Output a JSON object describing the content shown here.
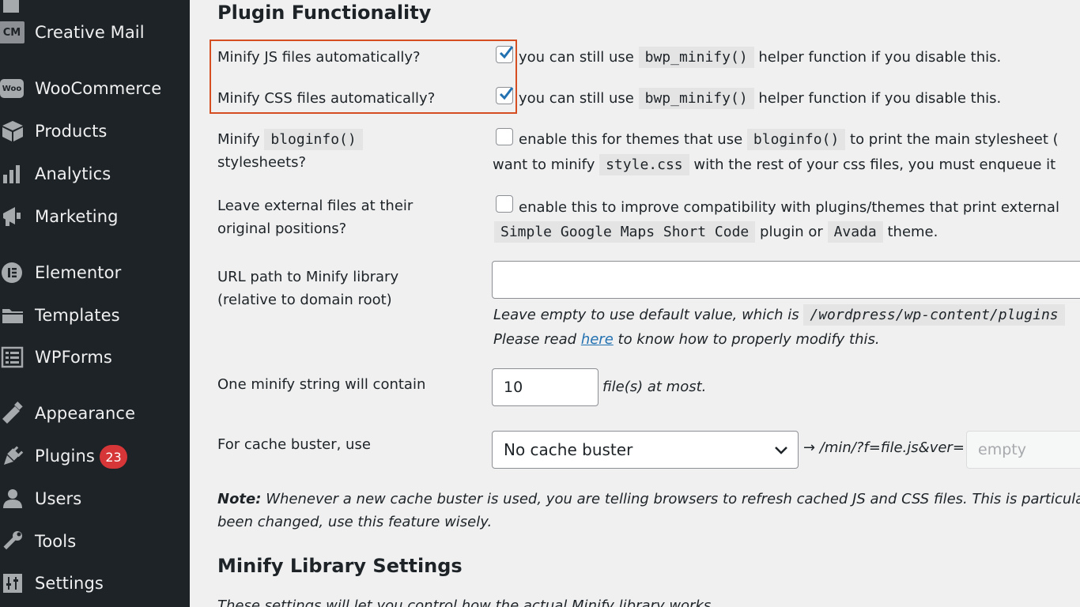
{
  "sidebar": {
    "items": [
      {
        "label": "Creative Mail",
        "icon": "creative-mail-icon",
        "icon_text": "CM"
      },
      {
        "label": "WooCommerce",
        "icon": "woocommerce-icon",
        "icon_text": "Woo"
      },
      {
        "label": "Products",
        "icon": "products-icon"
      },
      {
        "label": "Analytics",
        "icon": "analytics-icon"
      },
      {
        "label": "Marketing",
        "icon": "marketing-icon"
      },
      {
        "label": "Elementor",
        "icon": "elementor-icon"
      },
      {
        "label": "Templates",
        "icon": "templates-icon"
      },
      {
        "label": "WPForms",
        "icon": "wpforms-icon"
      },
      {
        "label": "Appearance",
        "icon": "appearance-icon"
      },
      {
        "label": "Plugins",
        "icon": "plugins-icon",
        "badge": "23"
      },
      {
        "label": "Users",
        "icon": "users-icon"
      },
      {
        "label": "Tools",
        "icon": "tools-icon"
      },
      {
        "label": "Settings",
        "icon": "settings-icon"
      }
    ]
  },
  "main": {
    "section_title": "Plugin Functionality",
    "js_row": {
      "label": "Minify JS files automatically?",
      "checked": true,
      "desc_pre": "you can still use",
      "code": "bwp_minify()",
      "desc_post": "helper function if you disable this."
    },
    "css_row": {
      "label": "Minify CSS files automatically?",
      "checked": true,
      "desc_pre": "you can still use",
      "code": "bwp_minify()",
      "desc_post": "helper function if you disable this."
    },
    "bloginfo_row": {
      "label_pre": "Minify",
      "label_code": "bloginfo()",
      "label_post": "stylesheets?",
      "checked": false,
      "desc1_pre": "enable this for themes that use",
      "desc1_code": "bloginfo()",
      "desc1_post": "to print the main stylesheet (",
      "desc2_pre": "want to minify",
      "desc2_code": "style.css",
      "desc2_post": "with the rest of your css files, you must enqueue it"
    },
    "external_row": {
      "label_line1": "Leave external files at their",
      "label_line2": "original positions?",
      "checked": false,
      "desc1": "enable this to improve compatibility with plugins/themes that print external",
      "desc2_code1": "Simple Google Maps Short Code",
      "desc2_mid": "plugin or",
      "desc2_code2": "Avada",
      "desc2_post": "theme."
    },
    "url_row": {
      "label_line1": "URL path to Minify library",
      "label_line2": "(relative to domain root)",
      "value": "",
      "hint1_pre": "Leave empty to use default value, which is",
      "hint1_code": "/wordpress/wp-content/plugins",
      "hint2_pre": "Please read",
      "hint2_link": "here",
      "hint2_post": "to know how to properly modify this."
    },
    "string_row": {
      "label": "One minify string will contain",
      "value": "10",
      "suffix": "file(s) at most."
    },
    "cache_row": {
      "label": "For cache buster, use",
      "selected": "No cache buster",
      "path_text": "→ /min/?f=file.js&ver=",
      "placeholder": "empty"
    },
    "note": {
      "bold": "Note:",
      "line1": "Whenever a new cache buster is used, you are telling browsers to refresh cached JS and CSS files. This is particularly",
      "line2": "been changed, use this feature wisely."
    },
    "section2_title": "Minify Library Settings",
    "section2_desc_partial": "These settings will let you control how the actual Minify library works."
  },
  "colors": {
    "sidebar_bg": "#1d2327",
    "badge": "#d63638",
    "highlight_border": "#d54e21",
    "checkmark": "#2271b1",
    "link": "#2271b1"
  }
}
